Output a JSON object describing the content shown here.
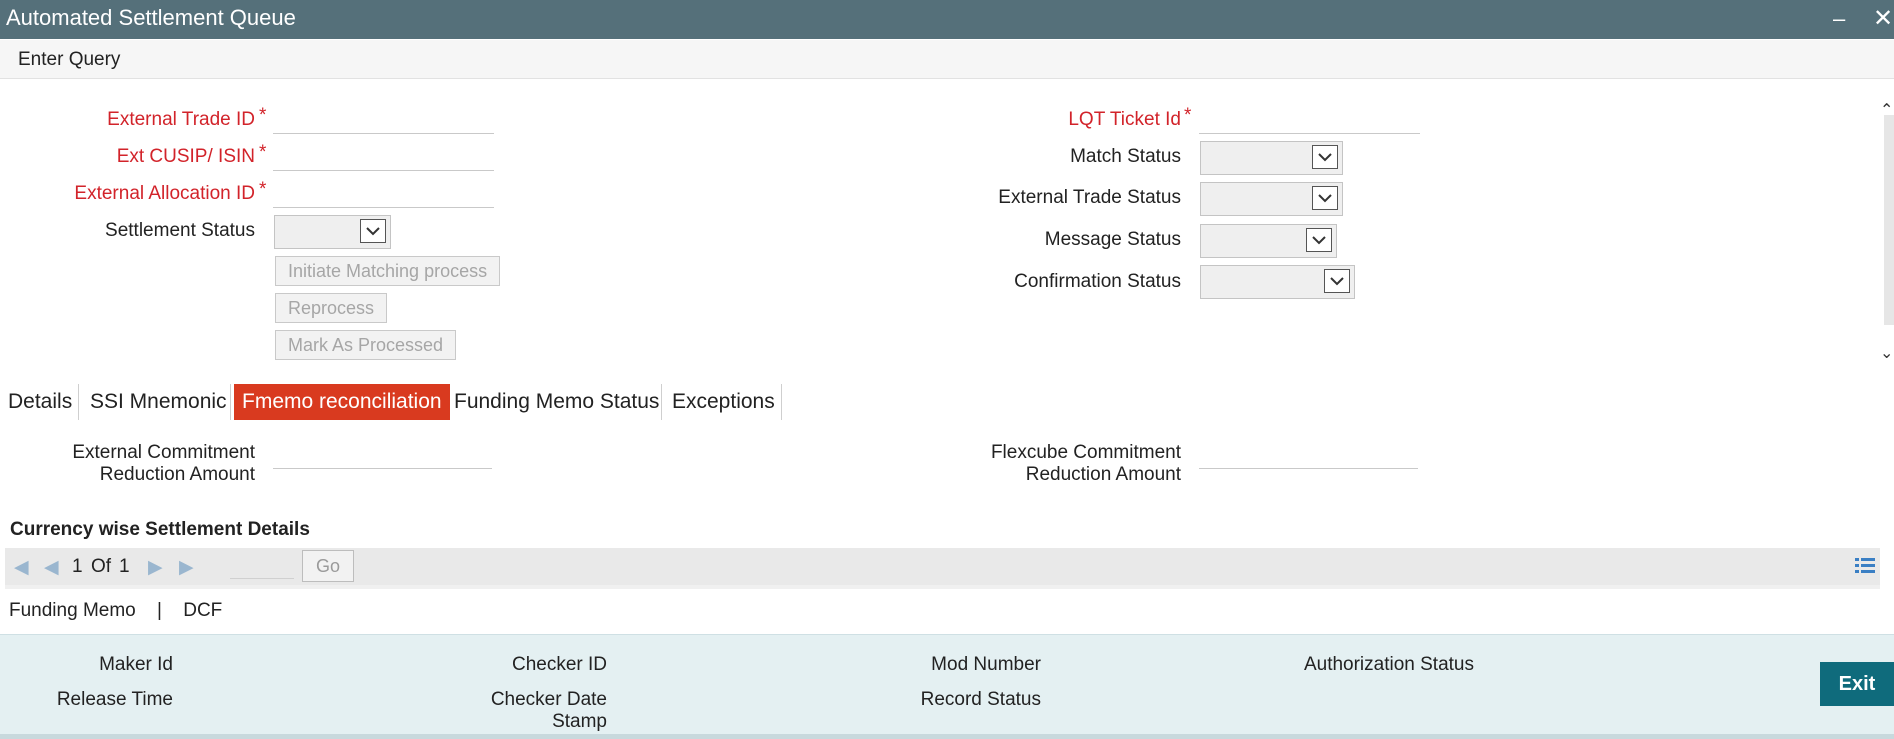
{
  "window": {
    "title": "Automated Settlement Queue",
    "minimize": "‒",
    "close": "✕"
  },
  "menubar": {
    "enter_query": "Enter Query"
  },
  "form": {
    "external_trade_id_label": "External Trade ID",
    "ext_cusip_isin_label": "Ext CUSIP/ ISIN",
    "external_allocation_id_label": "External Allocation ID",
    "settlement_status_label": "Settlement Status",
    "lqt_ticket_id_label": "LQT Ticket Id",
    "match_status_label": "Match Status",
    "external_trade_status_label": "External Trade Status",
    "message_status_label": "Message Status",
    "confirmation_status_label": "Confirmation Status",
    "required_marker": "*"
  },
  "actions": {
    "initiate_matching": "Initiate Matching process",
    "reprocess": "Reprocess",
    "mark_as_processed": "Mark As Processed"
  },
  "tabs": {
    "details": "Details",
    "ssi_mnemonic": "SSI Mnemonic",
    "fmemo_reconciliation": "Fmemo reconciliation",
    "funding_memo_status": "Funding Memo Status",
    "exceptions": "Exceptions",
    "active": "fmemo_reconciliation"
  },
  "reconciliation": {
    "external_commitment_line1": "External Commitment",
    "external_commitment_line2": "Reduction Amount",
    "flexcube_commitment_line1": "Flexcube Commitment",
    "flexcube_commitment_line2": "Reduction Amount"
  },
  "currency_section": {
    "title": "Currency wise Settlement Details",
    "page_current": "1",
    "page_of": "Of",
    "page_total": "1",
    "go_label": "Go"
  },
  "sublinks": {
    "funding_memo": "Funding Memo",
    "separator": "|",
    "dcf": "DCF"
  },
  "audit": {
    "maker_id": "Maker Id",
    "release_time": "Release Time",
    "checker_id": "Checker ID",
    "checker_date_line1": "Checker Date",
    "checker_date_line2": "Stamp",
    "mod_number": "Mod Number",
    "record_status": "Record Status",
    "authorization_status": "Authorization Status"
  },
  "exit_label": "Exit",
  "colors": {
    "titlebar": "#55707a",
    "required": "#d2232a",
    "active_tab": "#d93a1f",
    "exit_button": "#0f6b7c",
    "audit_bg": "#e4f0f2"
  }
}
